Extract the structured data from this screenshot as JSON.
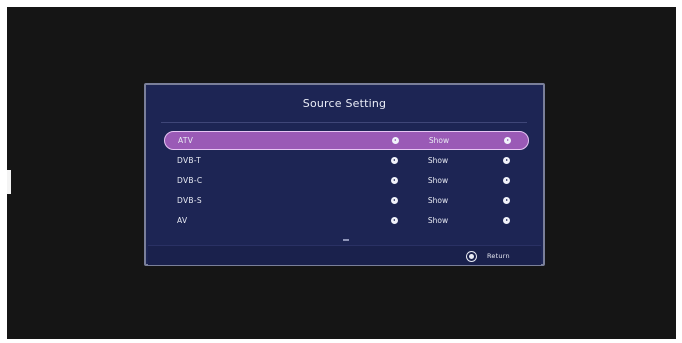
{
  "dialog": {
    "title": "Source Setting"
  },
  "sources": [
    {
      "name": "ATV",
      "value": "Show",
      "selected": true
    },
    {
      "name": "DVB-T",
      "value": "Show",
      "selected": false
    },
    {
      "name": "DVB-C",
      "value": "Show",
      "selected": false
    },
    {
      "name": "DVB-S",
      "value": "Show",
      "selected": false
    },
    {
      "name": "AV",
      "value": "Show",
      "selected": false
    }
  ],
  "footer": {
    "return_label": "Return",
    "return_icon": "return-icon"
  },
  "colors": {
    "dialog_bg": "#1d2554",
    "highlight": "#9a5ab6",
    "text": "#e8eaf3",
    "screen_bg": "#151515"
  }
}
